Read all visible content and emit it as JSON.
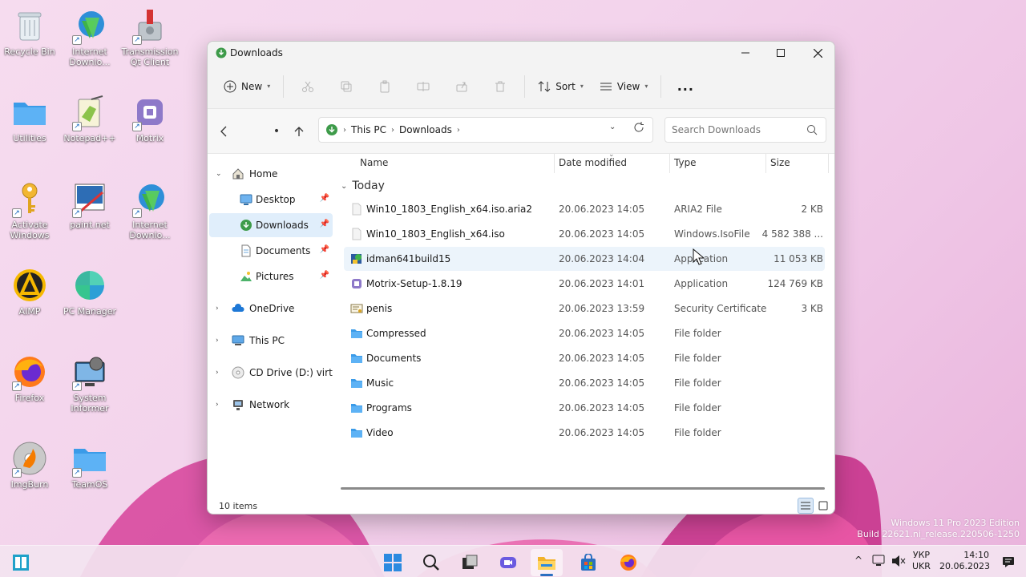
{
  "desktop": {
    "icons": [
      {
        "label": "Recycle Bin"
      },
      {
        "label": "Internet Downlo..."
      },
      {
        "label": "Transmission Qt Client"
      },
      {
        "label": "Utilities"
      },
      {
        "label": "Notepad++"
      },
      {
        "label": "Motrix"
      },
      {
        "label": "Activate Windows"
      },
      {
        "label": "paint.net"
      },
      {
        "label": "Internet Downlo..."
      },
      {
        "label": "AIMP"
      },
      {
        "label": "PC Manager"
      },
      {
        "label": "Firefox"
      },
      {
        "label": "System Informer"
      },
      {
        "label": "ImgBurn"
      },
      {
        "label": "TeamOS"
      }
    ],
    "watermark_line1": "Windows 11 Pro 2023 Edition",
    "watermark_line2": "Build 22621.ni_release.220506-1250"
  },
  "window": {
    "title": "Downloads",
    "toolbar": {
      "new_label": "New",
      "sort_label": "Sort",
      "view_label": "View",
      "more_label": "..."
    },
    "address": {
      "crumbs": [
        "This PC",
        "Downloads"
      ]
    },
    "search": {
      "placeholder": "Search Downloads"
    },
    "sidebar": {
      "items": [
        {
          "label": "Home"
        },
        {
          "label": "Desktop"
        },
        {
          "label": "Downloads"
        },
        {
          "label": "Documents"
        },
        {
          "label": "Pictures"
        },
        {
          "label": "OneDrive"
        },
        {
          "label": "This PC"
        },
        {
          "label": "CD Drive (D:) virtio-w"
        },
        {
          "label": "Network"
        }
      ]
    },
    "columns": {
      "name": "Name",
      "date": "Date modified",
      "type": "Type",
      "size": "Size"
    },
    "group_label": "Today",
    "files": [
      {
        "name": "Win10_1803_English_x64.iso.aria2",
        "date": "20.06.2023 14:05",
        "type": "ARIA2 File",
        "size": "2 KB"
      },
      {
        "name": "Win10_1803_English_x64.iso",
        "date": "20.06.2023 14:05",
        "type": "Windows.IsoFile",
        "size": "4 582 388 ..."
      },
      {
        "name": "idman641build15",
        "date": "20.06.2023 14:04",
        "type": "Application",
        "size": "11 053 KB"
      },
      {
        "name": "Motrix-Setup-1.8.19",
        "date": "20.06.2023 14:01",
        "type": "Application",
        "size": "124 769 KB"
      },
      {
        "name": "penis",
        "date": "20.06.2023 13:59",
        "type": "Security Certificate",
        "size": "3 KB"
      },
      {
        "name": "Compressed",
        "date": "20.06.2023 14:05",
        "type": "File folder",
        "size": ""
      },
      {
        "name": "Documents",
        "date": "20.06.2023 14:05",
        "type": "File folder",
        "size": ""
      },
      {
        "name": "Music",
        "date": "20.06.2023 14:05",
        "type": "File folder",
        "size": ""
      },
      {
        "name": "Programs",
        "date": "20.06.2023 14:05",
        "type": "File folder",
        "size": ""
      },
      {
        "name": "Video",
        "date": "20.06.2023 14:05",
        "type": "File folder",
        "size": ""
      }
    ],
    "status": {
      "item_count": "10 items"
    }
  },
  "taskbar": {
    "lang_top": "УКР",
    "lang_bottom": "UKR",
    "time": "14:10",
    "date": "20.06.2023"
  },
  "colors": {
    "accent": "#0067c0",
    "folder": "#4aa3f0",
    "selection": "#e0eefb"
  }
}
